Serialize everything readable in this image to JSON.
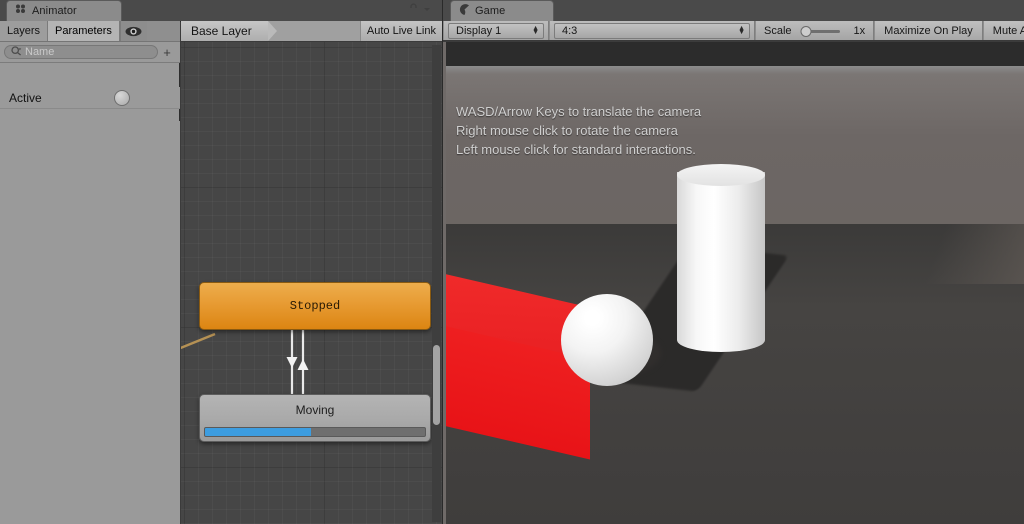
{
  "animator_panel": {
    "tab": {
      "label": "Animator",
      "icon": "animator-icon"
    },
    "corner_icons": [
      "lock-icon",
      "panel-menu-icon"
    ],
    "param_tabs": [
      {
        "label": "Layers",
        "active": false
      },
      {
        "label": "Parameters",
        "active": true
      }
    ],
    "eye_icon": "eye-icon",
    "search": {
      "placeholder": "Name",
      "value": "",
      "icon": "search-icon"
    },
    "add_parameter_button": "+",
    "parameters": [
      {
        "name": "Active",
        "type": "bool",
        "value": false
      }
    ],
    "graph_toolbar": {
      "breadcrumb": "Base Layer",
      "auto_live_link": "Auto Live Link"
    },
    "states": [
      {
        "name": "Stopped",
        "kind": "default-state",
        "color": "#e79b33",
        "progress": null
      },
      {
        "name": "Moving",
        "kind": "state",
        "color": "#a9a9a9",
        "progress": 48,
        "progress_color": "#3d9de0"
      }
    ],
    "transitions": [
      {
        "from": "Stopped",
        "to": "Moving",
        "direction": "down"
      },
      {
        "from": "Moving",
        "to": "Stopped",
        "direction": "up"
      },
      {
        "from": "Entry",
        "to": "Stopped",
        "direction": "entry",
        "color": "#b59154"
      }
    ]
  },
  "game_panel": {
    "tab": {
      "label": "Game",
      "icon": "game-icon"
    },
    "toolbar": {
      "display": "Display 1",
      "aspect": "4:3",
      "scale_label": "Scale",
      "scale_value": "1x",
      "scale_percent": 12,
      "maximize_on_play": "Maximize On Play",
      "mute_audio": "Mute A"
    },
    "overlay_lines": [
      "WASD/Arrow Keys to translate the camera",
      "Right mouse click to rotate the camera",
      "Left mouse click for standard interactions."
    ],
    "scene_objects": [
      {
        "name": "cube",
        "color": "#e81f22"
      },
      {
        "name": "sphere",
        "color": "#ffffff"
      },
      {
        "name": "cylinder",
        "color": "#ffffff"
      },
      {
        "name": "floor",
        "color": "#464442"
      }
    ]
  }
}
